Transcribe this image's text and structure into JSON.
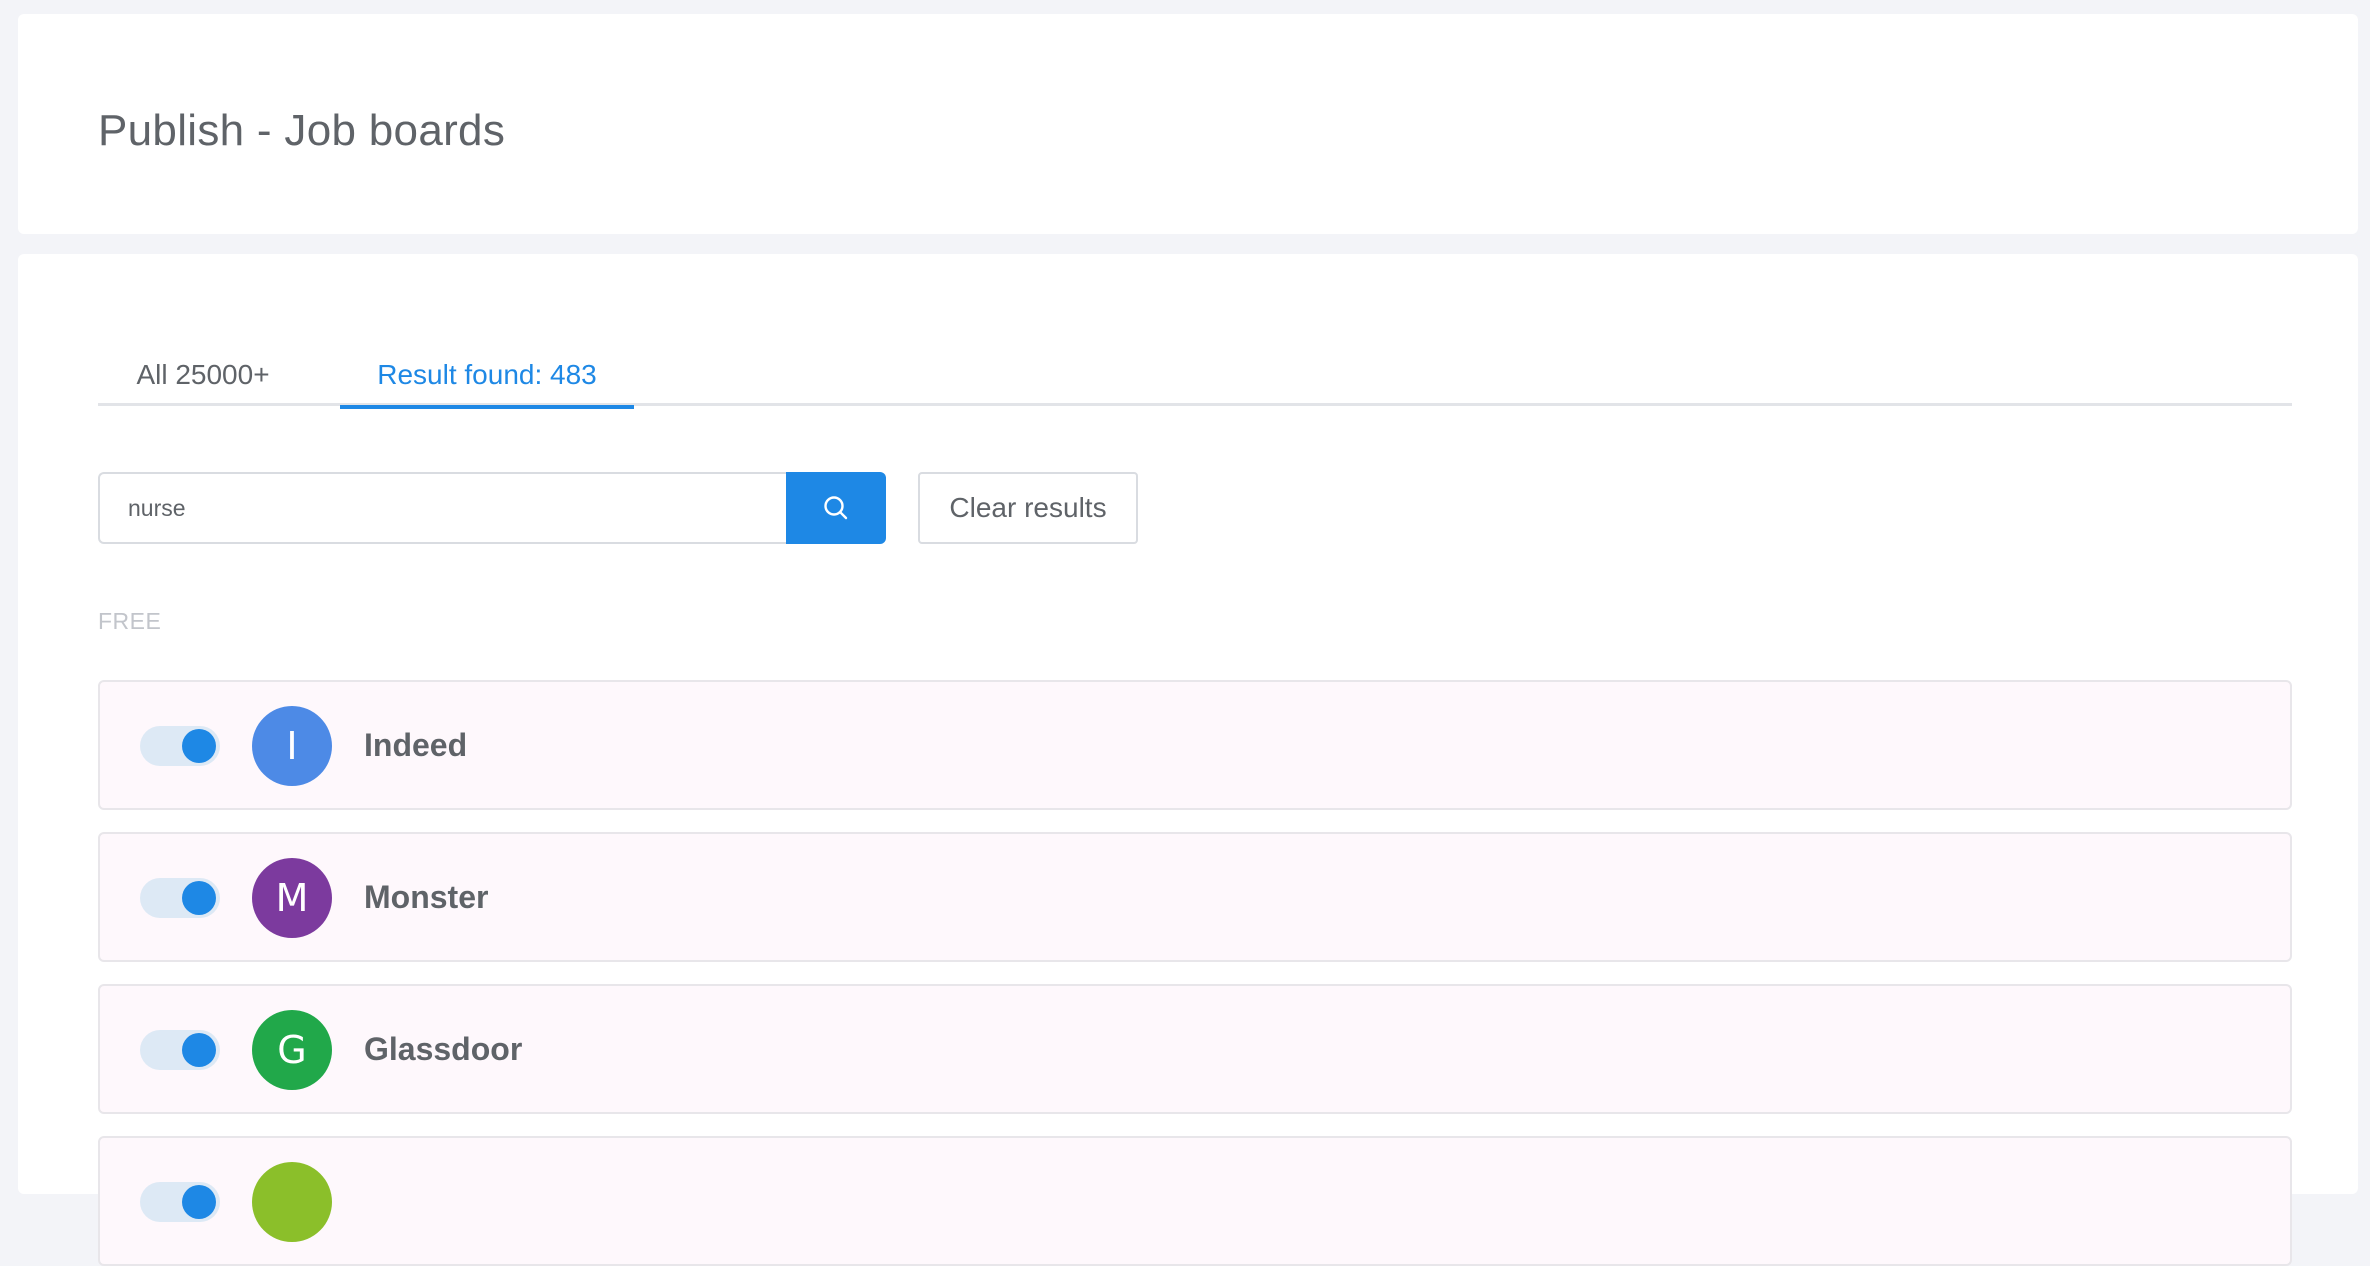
{
  "page": {
    "title": "Publish - Job boards"
  },
  "tabs": [
    {
      "label": "All 25000+",
      "active": false
    },
    {
      "label": "Result found: 483",
      "active": true
    }
  ],
  "search": {
    "value": "nurse",
    "icon": "search-icon"
  },
  "clear_button": {
    "label": "Clear results"
  },
  "section": {
    "label": "FREE"
  },
  "boards": [
    {
      "initial": "I",
      "name": "Indeed",
      "color": "#4d8ae6",
      "enabled": true
    },
    {
      "initial": "M",
      "name": "Monster",
      "color": "#7c3a9e",
      "enabled": true
    },
    {
      "initial": "G",
      "name": "Glassdoor",
      "color": "#21a84a",
      "enabled": true
    },
    {
      "initial": "",
      "name": "",
      "color": "#8bbf2a",
      "enabled": true
    }
  ],
  "colors": {
    "accent": "#1e88e5",
    "row_background": "#fef8fc"
  }
}
